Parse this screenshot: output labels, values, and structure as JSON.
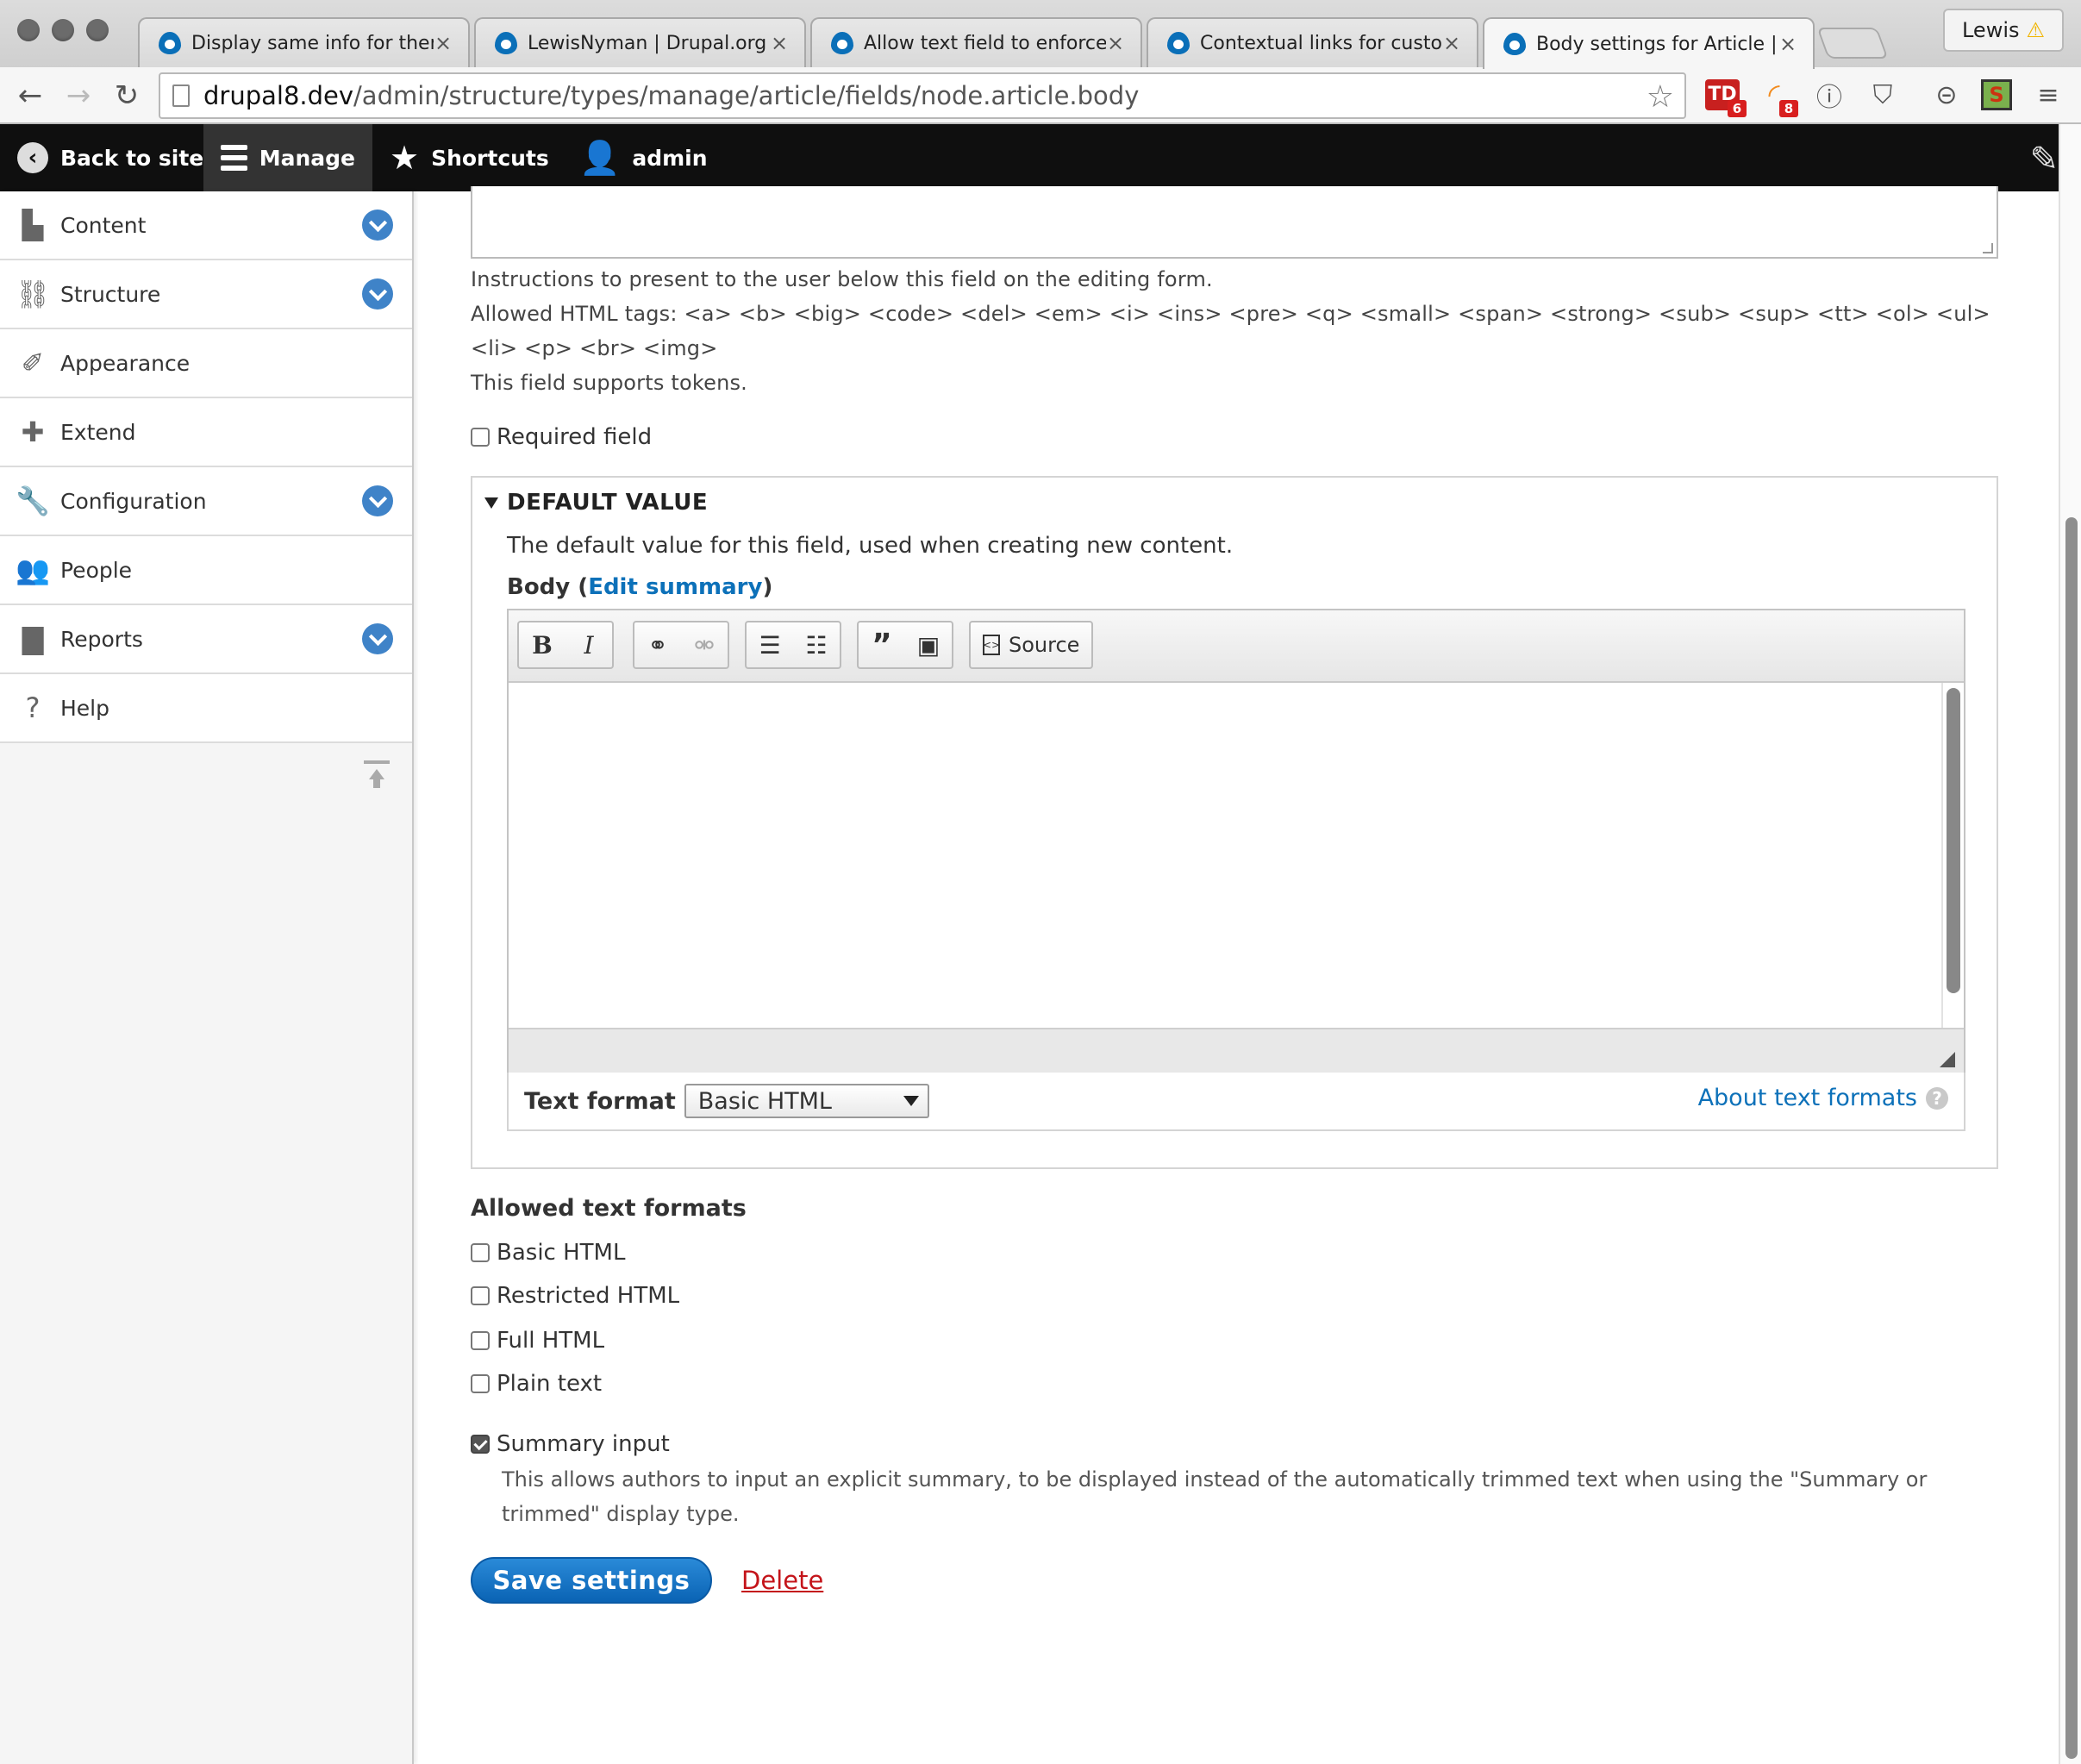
{
  "browser": {
    "tabs": [
      {
        "title": "Display same info for theme"
      },
      {
        "title": "LewisNyman | Drupal.org"
      },
      {
        "title": "Allow text field to enforce a"
      },
      {
        "title": "Contextual links for custom"
      },
      {
        "title": "Body settings for Article | Si"
      }
    ],
    "profile_name": "Lewis",
    "url_host": "drupal8.dev",
    "url_path": "/admin/structure/types/manage/article/fields/node.article.body",
    "extension_badges": {
      "td": "6",
      "rss": "8"
    }
  },
  "admin_toolbar": {
    "back_to_site": "Back to site",
    "manage": "Manage",
    "shortcuts": "Shortcuts",
    "user": "admin"
  },
  "sidebar": {
    "items": [
      {
        "label": "Content",
        "expandable": true
      },
      {
        "label": "Structure",
        "expandable": true
      },
      {
        "label": "Appearance",
        "expandable": false
      },
      {
        "label": "Extend",
        "expandable": false
      },
      {
        "label": "Configuration",
        "expandable": true
      },
      {
        "label": "People",
        "expandable": false
      },
      {
        "label": "Reports",
        "expandable": true
      },
      {
        "label": "Help",
        "expandable": false
      }
    ]
  },
  "help_text": {
    "line1": "Instructions to present to the user below this field on the editing form.",
    "line2": "Allowed HTML tags: <a> <b> <big> <code> <del> <em> <i> <ins> <pre> <q> <small> <span> <strong> <sub> <sup> <tt> <ol> <ul>",
    "line3": "<li> <p> <br> <img>",
    "line4": "This field supports tokens."
  },
  "required_field": {
    "label": "Required field",
    "checked": false
  },
  "default_value": {
    "legend": "DEFAULT VALUE",
    "description": "The default value for this field, used when creating new content.",
    "body_label": "Body",
    "edit_summary": "Edit summary",
    "toolbar": {
      "bold": "B",
      "italic": "I",
      "source": "Source"
    },
    "text_format_label": "Text format",
    "text_format_value": "Basic HTML",
    "about_text_formats": "About text formats"
  },
  "allowed_text_formats": {
    "heading": "Allowed text formats",
    "options": [
      {
        "label": "Basic HTML",
        "checked": false
      },
      {
        "label": "Restricted HTML",
        "checked": false
      },
      {
        "label": "Full HTML",
        "checked": false
      },
      {
        "label": "Plain text",
        "checked": false
      }
    ]
  },
  "summary_input": {
    "label": "Summary input",
    "checked": true,
    "description1": "This allows authors to input an explicit summary, to be displayed instead of the automatically trimmed text when using the \"Summary or",
    "description2": "trimmed\" display type."
  },
  "actions": {
    "save": "Save settings",
    "delete": "Delete"
  },
  "colors": {
    "primary_button": "#0a63b4",
    "link": "#0d71b9",
    "delete": "#c4141a",
    "toolbar_bg": "#0f0f0f",
    "menu_chevron": "#3f83c8"
  }
}
